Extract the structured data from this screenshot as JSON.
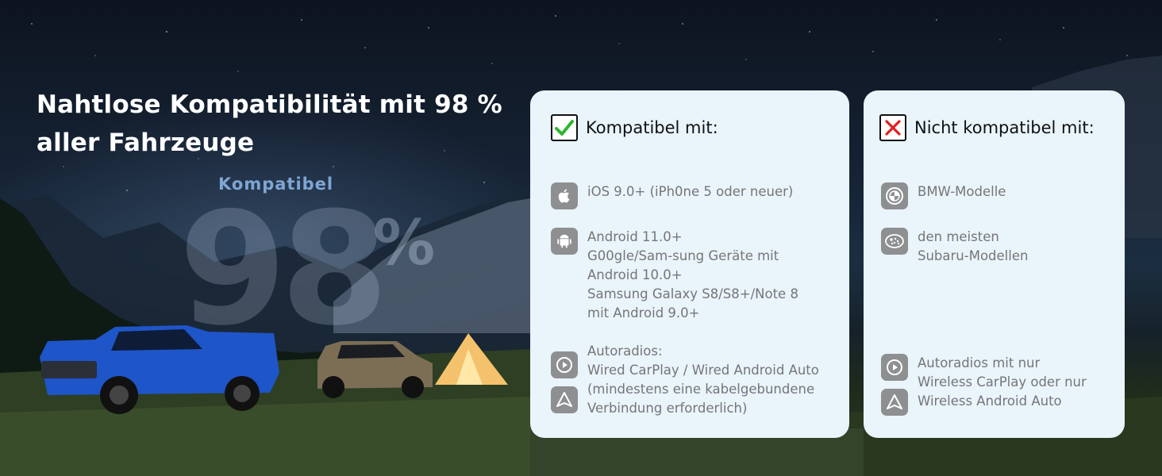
{
  "hero": {
    "title_line1": "Nahtlose Kompatibilität mit 98 %",
    "title_line2": "aller Fahrzeuge",
    "stat_label": "Kompatibel",
    "stat_value": "98",
    "stat_unit": "%"
  },
  "compatible": {
    "title": "Kompatibel mit:",
    "items": [
      {
        "icon": "apple-icon",
        "text": "iOS 9.0+ (iPh0ne 5 oder neuer)"
      },
      {
        "icon": "android-icon",
        "text": "Android 11.0+\nG00gle/Sam-sung Geräte mit\nAndroid 10.0+\nSamsung Galaxy S8/S8+/Note 8\nmit Android 9.0+"
      },
      {
        "icon": "carplay-androidauto-icons",
        "text": "Autoradios:\nWired CarPlay / Wired Android Auto\n(mindestens eine kabelgebundene\nVerbindung erforderlich)"
      }
    ]
  },
  "incompatible": {
    "title": "Nicht kompatibel mit:",
    "items": [
      {
        "icon": "bmw-logo-icon",
        "text": "BMW-Modelle"
      },
      {
        "icon": "subaru-logo-icon",
        "text": "den meisten\nSubaru-Modellen"
      },
      {
        "icon": "carplay-androidauto-icons",
        "text": "Autoradios mit nur\nWireless CarPlay oder nur\nWireless Android Auto"
      }
    ]
  },
  "colors": {
    "card_bg": "#e9f4fb",
    "icon_bg": "#8e8f90",
    "check_green": "#2fb52f",
    "cross_red": "#e02020"
  }
}
